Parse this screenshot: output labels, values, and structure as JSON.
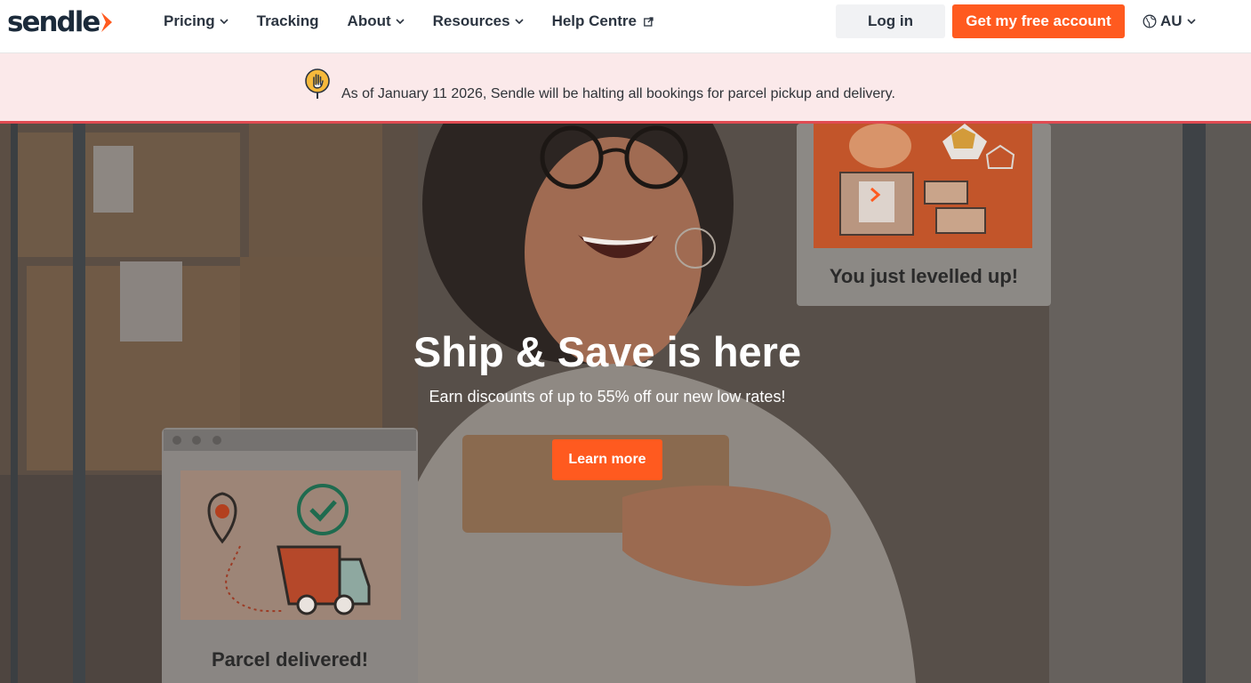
{
  "brand": {
    "name": "sendle",
    "accent": "#ff5a1f",
    "dark": "#1b2a3a"
  },
  "nav": {
    "items": [
      {
        "label": "Pricing",
        "has_dropdown": true
      },
      {
        "label": "Tracking",
        "has_dropdown": false
      },
      {
        "label": "About",
        "has_dropdown": true
      },
      {
        "label": "Resources",
        "has_dropdown": true
      },
      {
        "label": "Help Centre",
        "external": true
      }
    ],
    "login_label": "Log in",
    "signup_label": "Get my free account",
    "locale_label": "AU"
  },
  "notice": {
    "icon": "hand-stop-icon",
    "text": "As of January 11 2026, Sendle will be halting all bookings for parcel pickup and delivery.",
    "background": "#fbe9ea",
    "border": "#e04b52"
  },
  "hero": {
    "title": "Ship & Save is here",
    "subtitle": "Earn discounts of up to 55% off our new low rates!",
    "cta_label": "Learn more",
    "card_levelled": "You just levelled up!",
    "card_delivered": "Parcel delivered!"
  }
}
